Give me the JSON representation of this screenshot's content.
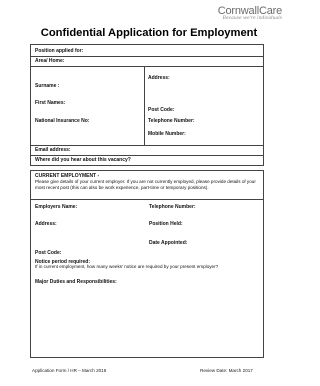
{
  "logo": {
    "name": "CornwallCare",
    "tagline": "Because we're individuals"
  },
  "title": "Confidential Application for Employment",
  "section1": {
    "position_applied": "Position applied for:",
    "area_home": "Area/ Home:",
    "surname": "Surname :",
    "address": "Address:",
    "first_names": "First Names:",
    "post_code": "Post Code:",
    "ni_no": "National Insurance No:",
    "telephone": "Telephone Number:",
    "mobile": "Mobile Number:",
    "email": "Email address:",
    "heard": "Where did you hear about this vacancy?"
  },
  "section2": {
    "heading": "CURRENT EMPLOYMENT -",
    "intro": "Please give details of your current employer. If you are not currently employed, please provide details of your most recent post (this can also be work experience, part-time or temporary positions).",
    "employers_name": "Employers Name:",
    "telephone": "Telephone Number:",
    "address": "Address:",
    "position_held": "Position Held:",
    "date_appointed": "Date Appointed:",
    "post_code": "Post Code:",
    "notice_heading": "Notice period required:",
    "notice_text": "If in current employment, how many weeks' notice are required by your present employer?",
    "duties": "Major Duties and Responsibilities:"
  },
  "footer": {
    "left": "Application Form / HR – March 2016",
    "right": "Review Date: March 2017"
  }
}
